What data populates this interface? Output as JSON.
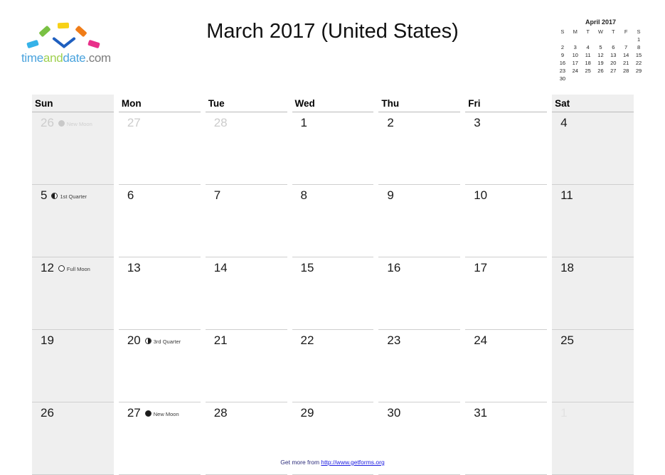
{
  "brand": {
    "name_parts": [
      "time",
      "and",
      "date",
      ".com"
    ],
    "full_name": "timeanddate.com"
  },
  "header": {
    "title": "March 2017 (United States)"
  },
  "mini_calendar": {
    "title": "April 2017",
    "weekday_initials": [
      "S",
      "M",
      "T",
      "W",
      "T",
      "F",
      "S"
    ],
    "weeks": [
      [
        "",
        "",
        "",
        "",
        "",
        "",
        "1"
      ],
      [
        "2",
        "3",
        "4",
        "5",
        "6",
        "7",
        "8"
      ],
      [
        "9",
        "10",
        "11",
        "12",
        "13",
        "14",
        "15"
      ],
      [
        "16",
        "17",
        "18",
        "19",
        "20",
        "21",
        "22"
      ],
      [
        "23",
        "24",
        "25",
        "26",
        "27",
        "28",
        "29"
      ],
      [
        "30",
        "",
        "",
        "",
        "",
        "",
        ""
      ]
    ]
  },
  "calendar": {
    "weekday_headers": [
      "Sun",
      "Mon",
      "Tue",
      "Wed",
      "Thu",
      "Fri",
      "Sat"
    ],
    "weeks": [
      [
        {
          "num": "26",
          "kind": "prev",
          "moon": "new",
          "moon_label": "New Moon"
        },
        {
          "num": "27",
          "kind": "prev"
        },
        {
          "num": "28",
          "kind": "prev"
        },
        {
          "num": "1",
          "kind": "current"
        },
        {
          "num": "2",
          "kind": "current"
        },
        {
          "num": "3",
          "kind": "current"
        },
        {
          "num": "4",
          "kind": "current"
        }
      ],
      [
        {
          "num": "5",
          "kind": "current",
          "moon": "first",
          "moon_label": "1st Quarter"
        },
        {
          "num": "6",
          "kind": "current"
        },
        {
          "num": "7",
          "kind": "current"
        },
        {
          "num": "8",
          "kind": "current"
        },
        {
          "num": "9",
          "kind": "current"
        },
        {
          "num": "10",
          "kind": "current"
        },
        {
          "num": "11",
          "kind": "current"
        }
      ],
      [
        {
          "num": "12",
          "kind": "current",
          "moon": "full",
          "moon_label": "Full Moon"
        },
        {
          "num": "13",
          "kind": "current"
        },
        {
          "num": "14",
          "kind": "current"
        },
        {
          "num": "15",
          "kind": "current"
        },
        {
          "num": "16",
          "kind": "current"
        },
        {
          "num": "17",
          "kind": "current"
        },
        {
          "num": "18",
          "kind": "current"
        }
      ],
      [
        {
          "num": "19",
          "kind": "current"
        },
        {
          "num": "20",
          "kind": "current",
          "moon": "third",
          "moon_label": "3rd Quarter"
        },
        {
          "num": "21",
          "kind": "current"
        },
        {
          "num": "22",
          "kind": "current"
        },
        {
          "num": "23",
          "kind": "current"
        },
        {
          "num": "24",
          "kind": "current"
        },
        {
          "num": "25",
          "kind": "current"
        }
      ],
      [
        {
          "num": "26",
          "kind": "current"
        },
        {
          "num": "27",
          "kind": "current",
          "moon": "new",
          "moon_label": "New Moon"
        },
        {
          "num": "28",
          "kind": "current"
        },
        {
          "num": "29",
          "kind": "current"
        },
        {
          "num": "30",
          "kind": "current"
        },
        {
          "num": "31",
          "kind": "current"
        },
        {
          "num": "1",
          "kind": "next"
        }
      ]
    ]
  },
  "footer": {
    "prefix": "Get more from ",
    "link_text": "http://www.getforms.org"
  }
}
